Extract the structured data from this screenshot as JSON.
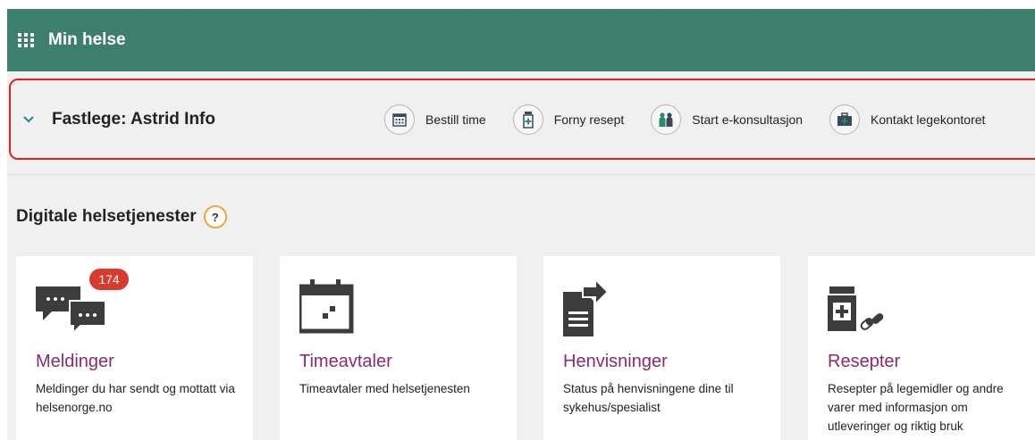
{
  "header": {
    "title": "Min helse",
    "menu_icon": "apps-grid-icon",
    "color": "#3d7e6c"
  },
  "gp": {
    "name": "Fastlege: Astrid Info",
    "toggle_icon": "chevron-down-icon",
    "highlight_color": "#e0211d",
    "actions": [
      {
        "label": "Bestill time",
        "icon": "calendar-icon"
      },
      {
        "label": "Forny resept",
        "icon": "pill-bottle-icon"
      },
      {
        "label": "Start e-konsultasjon",
        "icon": "people-icon"
      },
      {
        "label": "Kontakt legekontoret",
        "icon": "medical-kit-icon"
      }
    ]
  },
  "section": {
    "title": "Digitale helsetjenester",
    "help_label": "?"
  },
  "cards": [
    {
      "title": "Meldinger",
      "description": "Meldinger du har sendt og mottatt via helsenorge.no",
      "badge": "174",
      "icon": "chat-bubbles-icon"
    },
    {
      "title": "Timeavtaler",
      "description": "Timeavtaler med helsetjenesten",
      "icon": "calendar-icon"
    },
    {
      "title": "Henvisninger",
      "description": "Status på henvisningene dine til sykehus/spesialist",
      "icon": "document-arrow-icon"
    },
    {
      "title": "Resepter",
      "description": "Resepter på legemidler og andre varer med informasjon om utleveringer og riktig bruk",
      "icon": "prescription-icon"
    }
  ],
  "colors": {
    "card_title": "#8b2b6f",
    "badge": "#d93a2f",
    "help_ring": "#f2a33a",
    "icon_dark": "#3c3c3c"
  }
}
